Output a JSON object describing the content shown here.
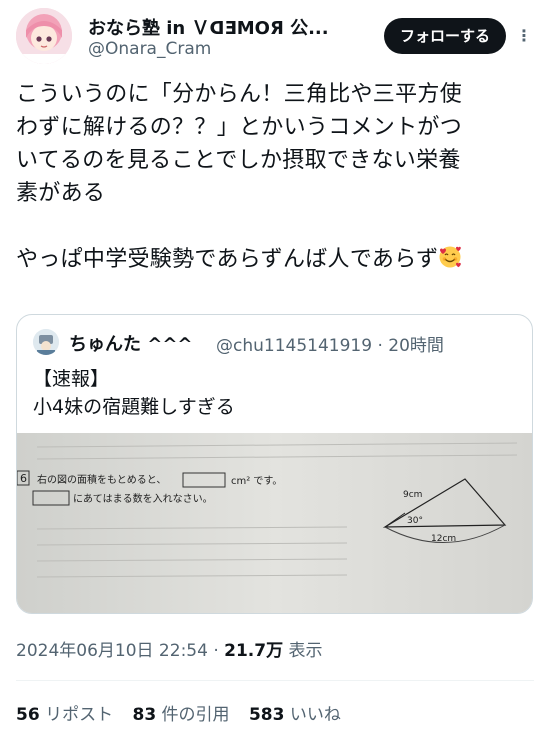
{
  "author": {
    "name": "おなら塾 in ＶᗡƎMOЯ 公...",
    "handle": "@Onara_Cram"
  },
  "follow_label": "フォローする",
  "more_label": "⋮",
  "body_lines": [
    "こういうのに「分からん！三角比や三平方使",
    "わずに解けるの？？」とかいうコメントがつ",
    "いてるのを見ることでしか摂取できない栄養",
    "素がある",
    "",
    "やっぱ中学受験勢であらずんば人であらず"
  ],
  "quote": {
    "name": "ちゅんた ^^^",
    "handle_time": "@chu1145141919 · 20時間",
    "lines": [
      "【速報】",
      "小4妹の宿題難しすぎる"
    ],
    "image": {
      "problem_number": "6",
      "line1": "右の図の面積をもとめると、",
      "unit": "cm² です。",
      "line2": "にあてはまる数を入れなさい。",
      "label_9": "9cm",
      "label_30": "30°",
      "label_12": "12cm"
    }
  },
  "meta": {
    "datetime": "2024年06月10日 22:54 · ",
    "views": "21.7万",
    "views_label": " 表示"
  },
  "stats": [
    {
      "num": "56",
      "label": " リポスト"
    },
    {
      "num": "83",
      "label": " 件の引用"
    },
    {
      "num": "583",
      "label": " いいね"
    }
  ],
  "colors": {
    "accent": "#0f1419",
    "muted": "#536471",
    "border": "#cfd9de"
  }
}
